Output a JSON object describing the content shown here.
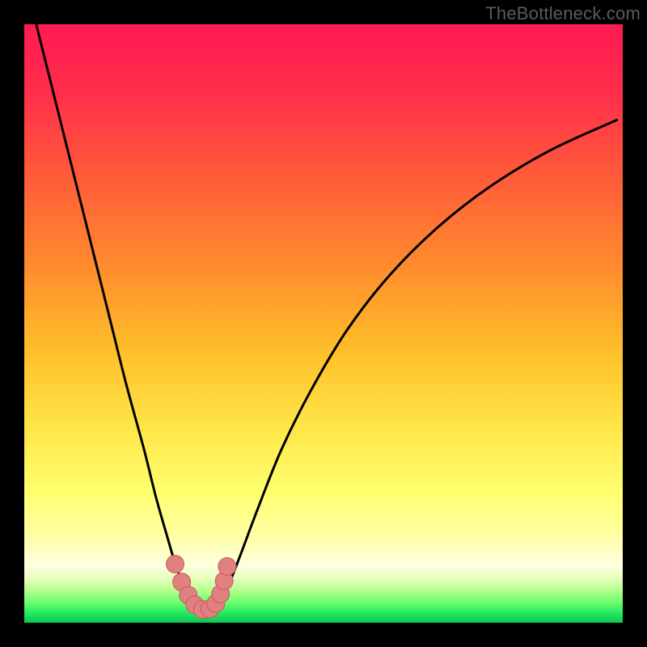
{
  "watermark": "TheBottleneck.com",
  "colors": {
    "frame": "#000000",
    "curve": "#000000",
    "marker_fill": "#e08080",
    "marker_stroke": "#c65b5b",
    "gradient_stops": [
      {
        "offset": 0.0,
        "color": "#ff1a53"
      },
      {
        "offset": 0.12,
        "color": "#ff2f4a"
      },
      {
        "offset": 0.25,
        "color": "#ff5a3a"
      },
      {
        "offset": 0.4,
        "color": "#ff8a2e"
      },
      {
        "offset": 0.55,
        "color": "#ffc02a"
      },
      {
        "offset": 0.68,
        "color": "#ffe74a"
      },
      {
        "offset": 0.78,
        "color": "#ffff6e"
      },
      {
        "offset": 0.85,
        "color": "#ffffa0"
      },
      {
        "offset": 0.905,
        "color": "#ffffe0"
      },
      {
        "offset": 0.925,
        "color": "#e8ffbe"
      },
      {
        "offset": 0.945,
        "color": "#b7ff8e"
      },
      {
        "offset": 0.965,
        "color": "#6fff6e"
      },
      {
        "offset": 0.985,
        "color": "#20e860"
      },
      {
        "offset": 1.0,
        "color": "#0cc64e"
      }
    ]
  },
  "chart_data": {
    "type": "line",
    "title": "",
    "xlabel": "",
    "ylabel": "",
    "xlim": [
      0,
      100
    ],
    "ylim": [
      0,
      100
    ],
    "series": [
      {
        "name": "bottleneck-curve",
        "x": [
          2,
          5,
          8,
          11,
          14,
          17,
          20,
          22,
          24,
          25.5,
          27,
          28.2,
          29,
          30,
          31,
          32.5,
          34,
          36,
          39,
          43,
          48,
          54,
          61,
          69,
          78,
          88,
          99
        ],
        "y": [
          100,
          88,
          76,
          64,
          52,
          40,
          29,
          21,
          14,
          9,
          5.5,
          3.2,
          2.3,
          2.1,
          2.3,
          3.4,
          6,
          11,
          19,
          29,
          39,
          49,
          58,
          66,
          73,
          79,
          84
        ]
      }
    ],
    "markers": {
      "name": "highlight-markers",
      "x": [
        25.2,
        26.3,
        27.4,
        28.5,
        29.8,
        31.0,
        32.0,
        32.8,
        33.4,
        33.9
      ],
      "y": [
        9.8,
        6.8,
        4.6,
        3.0,
        2.2,
        2.3,
        3.2,
        4.8,
        7.0,
        9.4
      ]
    }
  }
}
